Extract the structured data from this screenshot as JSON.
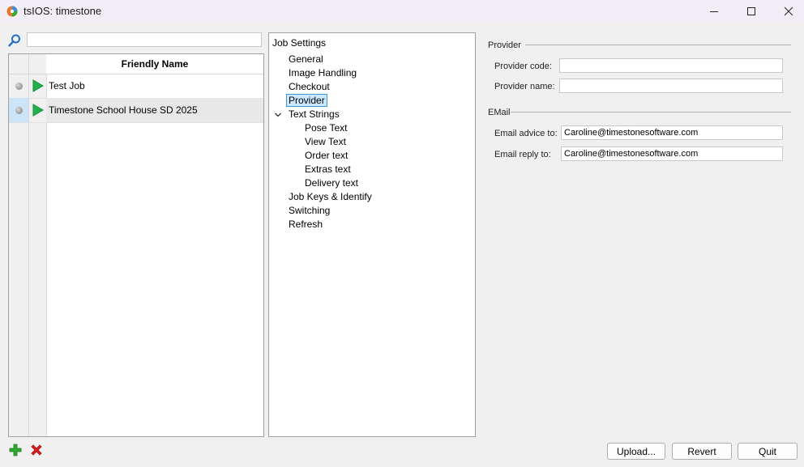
{
  "window": {
    "title": "tsIOS: timestone"
  },
  "search": {
    "value": "",
    "placeholder": ""
  },
  "job_list": {
    "column_header": "Friendly Name",
    "rows": [
      {
        "name": "Test Job"
      },
      {
        "name": "Timestone School House SD 2025",
        "selected": true
      }
    ]
  },
  "tree": {
    "root": "Job Settings",
    "items": [
      {
        "label": "General"
      },
      {
        "label": "Image Handling"
      },
      {
        "label": "Checkout"
      },
      {
        "label": "Provider",
        "selected": true
      },
      {
        "label": "Text Strings",
        "expanded": true
      },
      {
        "label": "Pose Text"
      },
      {
        "label": "View Text"
      },
      {
        "label": "Order text"
      },
      {
        "label": "Extras text"
      },
      {
        "label": "Delivery text"
      },
      {
        "label": "Job Keys & Identify"
      },
      {
        "label": "Switching"
      },
      {
        "label": "Refresh"
      }
    ]
  },
  "provider": {
    "group_label": "Provider",
    "code_label": "Provider code:",
    "code_value": "",
    "name_label": "Provider name:",
    "name_value": ""
  },
  "email": {
    "group_label": "EMail",
    "advice_label": "Email advice to:",
    "advice_value": "Caroline@timestonesoftware.com",
    "reply_label": "Email reply to:",
    "reply_value": "Caroline@timestonesoftware.com"
  },
  "buttons": {
    "upload": "Upload...",
    "revert": "Revert",
    "quit": "Quit"
  },
  "icons": {
    "app": "app-icon",
    "search": "search-icon",
    "add": "add-icon",
    "delete": "delete-icon",
    "play": "play-icon",
    "status": "status-dot-icon",
    "expand": "chevron-down-icon"
  },
  "colors": {
    "selection": "#cce8ff",
    "play_green": "#22b14c",
    "delete_red": "#e02020",
    "add_green": "#2eaa2e"
  }
}
